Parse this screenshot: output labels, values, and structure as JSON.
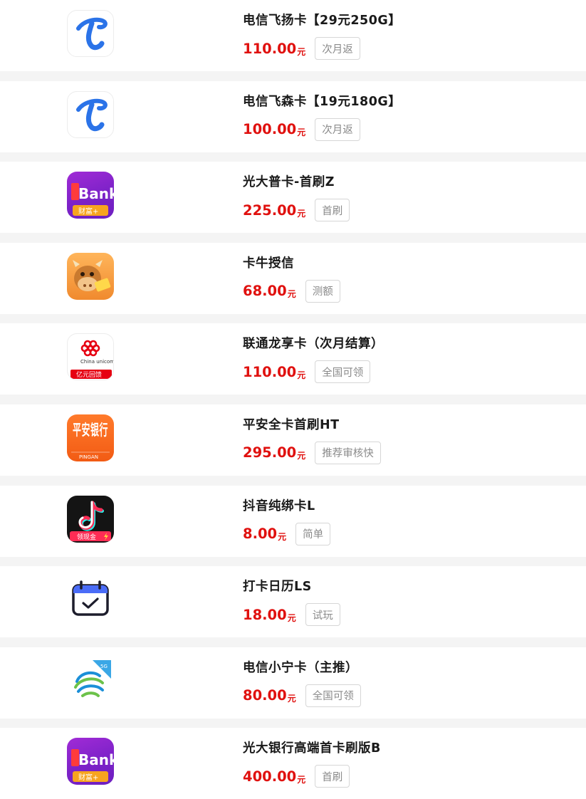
{
  "items": [
    {
      "title": "电信飞扬卡【29元250G】",
      "price": "110.00",
      "unit": "元",
      "tag": "次月返",
      "icon": "china-telecom-icon"
    },
    {
      "title": "电信飞森卡【19元180G】",
      "price": "100.00",
      "unit": "元",
      "tag": "次月返",
      "icon": "china-telecom-icon"
    },
    {
      "title": "光大普卡-首刷Z",
      "price": "225.00",
      "unit": "元",
      "tag": "首刷",
      "icon": "cebbank-app-icon",
      "icon_text": "Bank",
      "icon_sub": "财富+"
    },
    {
      "title": "卡牛授信",
      "price": "68.00",
      "unit": "元",
      "tag": "测额",
      "icon": "kaniu-cow-icon"
    },
    {
      "title": "联通龙享卡（次月结算）",
      "price": "110.00",
      "unit": "元",
      "tag": "全国可领",
      "icon": "china-unicom-icon",
      "icon_text": "China unicom",
      "icon_sub": "亿元回馈"
    },
    {
      "title": "平安全卡首刷HT",
      "price": "295.00",
      "unit": "元",
      "tag": "推荐审核快",
      "icon": "pingan-bank-icon",
      "icon_text": "平安银行",
      "icon_sub": "PINGAN"
    },
    {
      "title": "抖音纯绑卡L",
      "price": "8.00",
      "unit": "元",
      "tag": "简单",
      "icon": "douyin-icon",
      "icon_sub": "领现金"
    },
    {
      "title": "打卡日历LS",
      "price": "18.00",
      "unit": "元",
      "tag": "试玩",
      "icon": "calendar-check-icon"
    },
    {
      "title": "电信小宁卡（主推）",
      "price": "80.00",
      "unit": "元",
      "tag": "全国可领",
      "icon": "china-mobile-5g-icon",
      "icon_text": "5G"
    },
    {
      "title": "光大银行高端首卡刷版B",
      "price": "400.00",
      "unit": "元",
      "tag": "首刷",
      "icon": "cebbank-app-icon",
      "icon_text": "Bank",
      "icon_sub": "财富+"
    }
  ]
}
